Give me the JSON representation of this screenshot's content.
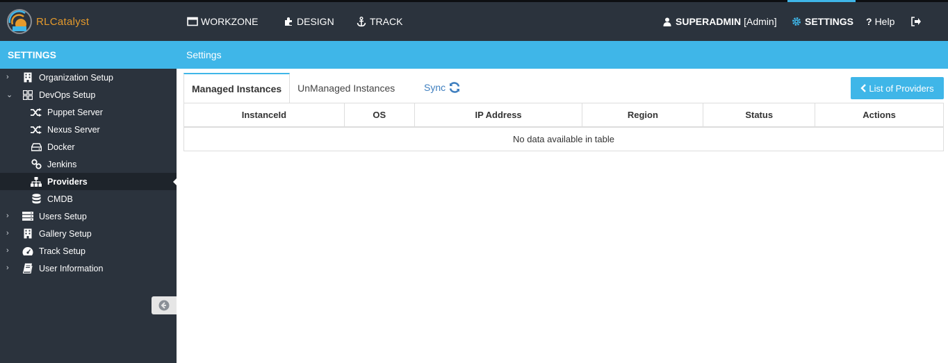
{
  "app": {
    "logo_text": "RLCatalyst"
  },
  "topnav": {
    "workzone": "WORKZONE",
    "design": "DESIGN",
    "track": "TRACK",
    "user": "SUPERADMIN",
    "role": "[Admin]",
    "settings": "SETTINGS",
    "help": "Help"
  },
  "sidebar": {
    "title": "SETTINGS",
    "items": [
      {
        "label": "Organization Setup"
      },
      {
        "label": "DevOps Setup"
      },
      {
        "label": "Puppet Server"
      },
      {
        "label": "Nexus Server"
      },
      {
        "label": "Docker"
      },
      {
        "label": "Jenkins"
      },
      {
        "label": "Providers"
      },
      {
        "label": "CMDB"
      },
      {
        "label": "Users Setup"
      },
      {
        "label": "Gallery Setup"
      },
      {
        "label": "Track Setup"
      },
      {
        "label": "User Information"
      }
    ]
  },
  "main": {
    "header": "Settings",
    "tabs": [
      "Managed Instances",
      "UnManaged Instances"
    ],
    "sync_label": "Sync",
    "providers_button": "List of Providers",
    "table": {
      "columns": [
        "InstanceId",
        "OS",
        "IP Address",
        "Region",
        "Status",
        "Actions"
      ],
      "empty_message": "No data available in table"
    }
  },
  "colors": {
    "accent": "#3fb6e8",
    "nav_bg": "#2b333d",
    "logo": "#e59a2c"
  }
}
